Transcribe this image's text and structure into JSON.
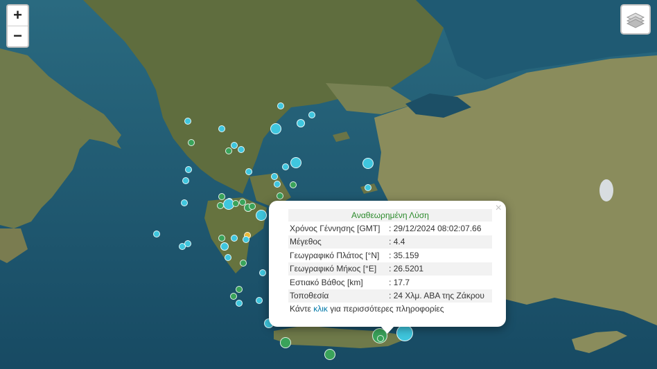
{
  "controls": {
    "zoom_in": "+",
    "zoom_out": "−",
    "layers_icon": "layers-icon"
  },
  "popup": {
    "title": "Αναθεωρημένη Λύση",
    "close": "×",
    "rows": [
      {
        "label": "Χρόνος Γέννησης [GMT]",
        "value": ": 29/12/2024 08:02:07.66"
      },
      {
        "label": "Μέγεθος",
        "value": ": 4.4"
      },
      {
        "label": "Γεωγραφικό Πλάτος [°N]",
        "value": ": 35.159"
      },
      {
        "label": "Γεωγραφικό Μήκος [°E]",
        "value": ": 26.5201"
      },
      {
        "label": "Εστιακό Βάθος [km]",
        "value": ": 17.7"
      },
      {
        "label": "Τοποθεσία",
        "value": ": 24 Χλμ. ΑΒΑ της Ζάκρου"
      }
    ],
    "more_prefix": "Κάντε ",
    "more_link": "κλικ",
    "more_suffix": " για περισσότερες πληροφορίες"
  },
  "colors": {
    "recent": "#3fc6de",
    "older": "#3aa35a",
    "selected": "#e8b93a"
  }
}
